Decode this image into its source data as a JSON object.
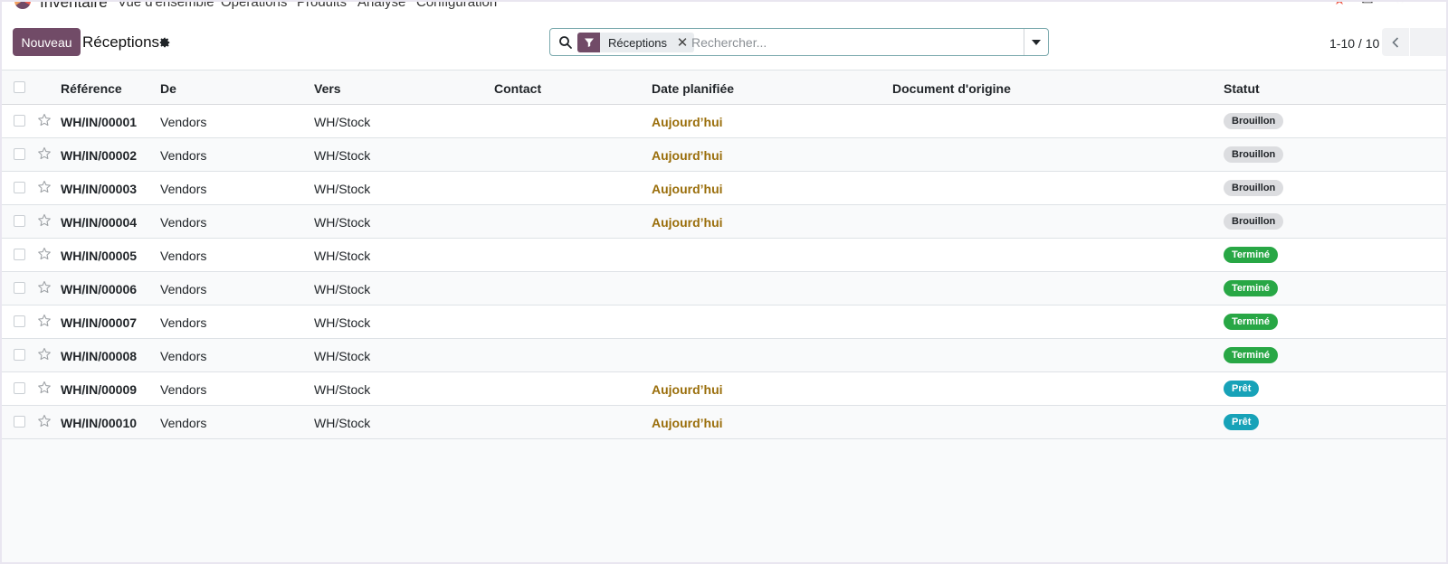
{
  "navbar": {
    "app_name": "Inventaire",
    "items": [
      "Vue d'ensemble",
      "Opérations",
      "Produits",
      "Analyse",
      "Configuration"
    ]
  },
  "control_panel": {
    "new_label": "Nouveau",
    "title": "Réceptions",
    "search": {
      "facet_label": "Réceptions",
      "placeholder": "Rechercher...",
      "value": ""
    },
    "pager": "1-10 / 10"
  },
  "colors": {
    "brand": "#714b67",
    "date_today": "#9a6e0b",
    "status_draft": "#dcdde0",
    "status_done": "#28a745",
    "status_ready": "#17a2b8"
  },
  "table": {
    "columns": [
      "Référence",
      "De",
      "Vers",
      "Contact",
      "Date planifiée",
      "Document d'origine",
      "Statut"
    ],
    "rows": [
      {
        "ref": "WH/IN/00001",
        "from": "Vendors",
        "to": "WH/Stock",
        "contact": "",
        "date": "Aujourd’hui",
        "origin": "",
        "status": "Brouillon",
        "status_kind": "draft"
      },
      {
        "ref": "WH/IN/00002",
        "from": "Vendors",
        "to": "WH/Stock",
        "contact": "",
        "date": "Aujourd’hui",
        "origin": "",
        "status": "Brouillon",
        "status_kind": "draft"
      },
      {
        "ref": "WH/IN/00003",
        "from": "Vendors",
        "to": "WH/Stock",
        "contact": "",
        "date": "Aujourd’hui",
        "origin": "",
        "status": "Brouillon",
        "status_kind": "draft"
      },
      {
        "ref": "WH/IN/00004",
        "from": "Vendors",
        "to": "WH/Stock",
        "contact": "",
        "date": "Aujourd’hui",
        "origin": "",
        "status": "Brouillon",
        "status_kind": "draft"
      },
      {
        "ref": "WH/IN/00005",
        "from": "Vendors",
        "to": "WH/Stock",
        "contact": "",
        "date": "",
        "origin": "",
        "status": "Terminé",
        "status_kind": "done"
      },
      {
        "ref": "WH/IN/00006",
        "from": "Vendors",
        "to": "WH/Stock",
        "contact": "",
        "date": "",
        "origin": "",
        "status": "Terminé",
        "status_kind": "done"
      },
      {
        "ref": "WH/IN/00007",
        "from": "Vendors",
        "to": "WH/Stock",
        "contact": "",
        "date": "",
        "origin": "",
        "status": "Terminé",
        "status_kind": "done"
      },
      {
        "ref": "WH/IN/00008",
        "from": "Vendors",
        "to": "WH/Stock",
        "contact": "",
        "date": "",
        "origin": "",
        "status": "Terminé",
        "status_kind": "done"
      },
      {
        "ref": "WH/IN/00009",
        "from": "Vendors",
        "to": "WH/Stock",
        "contact": "",
        "date": "Aujourd’hui",
        "origin": "",
        "status": "Prêt",
        "status_kind": "ready"
      },
      {
        "ref": "WH/IN/00010",
        "from": "Vendors",
        "to": "WH/Stock",
        "contact": "",
        "date": "Aujourd’hui",
        "origin": "",
        "status": "Prêt",
        "status_kind": "ready"
      }
    ]
  }
}
